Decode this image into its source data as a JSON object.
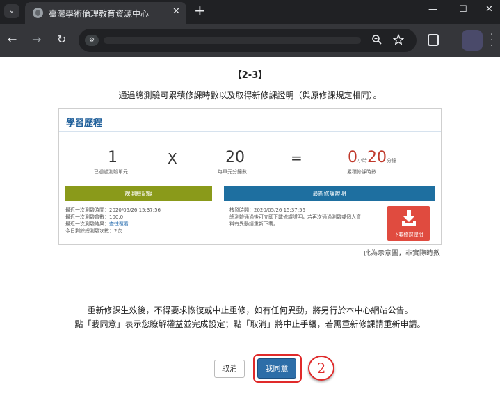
{
  "browser": {
    "tab_title": "臺灣學術倫理教育資源中心",
    "tab_close": "✕",
    "new_tab": "+",
    "nav_back": "←",
    "nav_forward": "→",
    "nav_reload": "↻",
    "window_minimize": "—",
    "window_maximize": "☐",
    "window_close": "✕",
    "icons": [
      "tab-search-icon",
      "globe-icon",
      "site-info-icon",
      "zoom-icon",
      "star-icon",
      "extensions-icon",
      "profile-avatar",
      "menu-icon"
    ]
  },
  "page": {
    "heading": "【2-3】",
    "subheading": "通過總測驗可累積修課時數以及取得新修課證明（與原修課規定相同）。",
    "panel": {
      "title": "學習歷程",
      "units_passed": {
        "value": "1",
        "label": "已通過測驗單元"
      },
      "times": "X",
      "minutes_per_unit": {
        "value": "20",
        "label": "每單元分鐘數"
      },
      "equals": "=",
      "total": {
        "hours": "0",
        "hours_unit": "小時",
        "minutes": "20",
        "minutes_unit": "分鐘",
        "label": "累積修課時數"
      },
      "quiz_record_label": "課測驗記錄",
      "certificate_label": "最新修課證明",
      "quiz_info": [
        "最近一次測驗時間：2020/05/26 15:37:56",
        "最近一次測驗曾數：100.0",
        "最近一次測驗結果：",
        "今日剩餘總測驗次數：2次"
      ],
      "quiz_result_link": "查往覆看",
      "cert_info": [
        "核發時間：2020/05/26 15:37:56",
        "總測驗通過後可立即下載修課證明，若再次通過測驗或個人資",
        "料有異動請重新下載。"
      ],
      "download_label": "下載修課證明"
    },
    "note": "此為示意圖，非實際時數",
    "warning_line1": "重新修課生效後，不得要求恢復或中止重修，如有任何異動，將另行於本中心網站公告。",
    "warning_line2": "點「我同意」表示您瞭解權益並完成設定；點「取消」將中止手續，若需重新修課請重新申請。",
    "cancel_label": "取消",
    "agree_label": "我同意",
    "step_number": "2",
    "accent_red": "#e02a2a",
    "button_blue": "#2d6ea8"
  }
}
